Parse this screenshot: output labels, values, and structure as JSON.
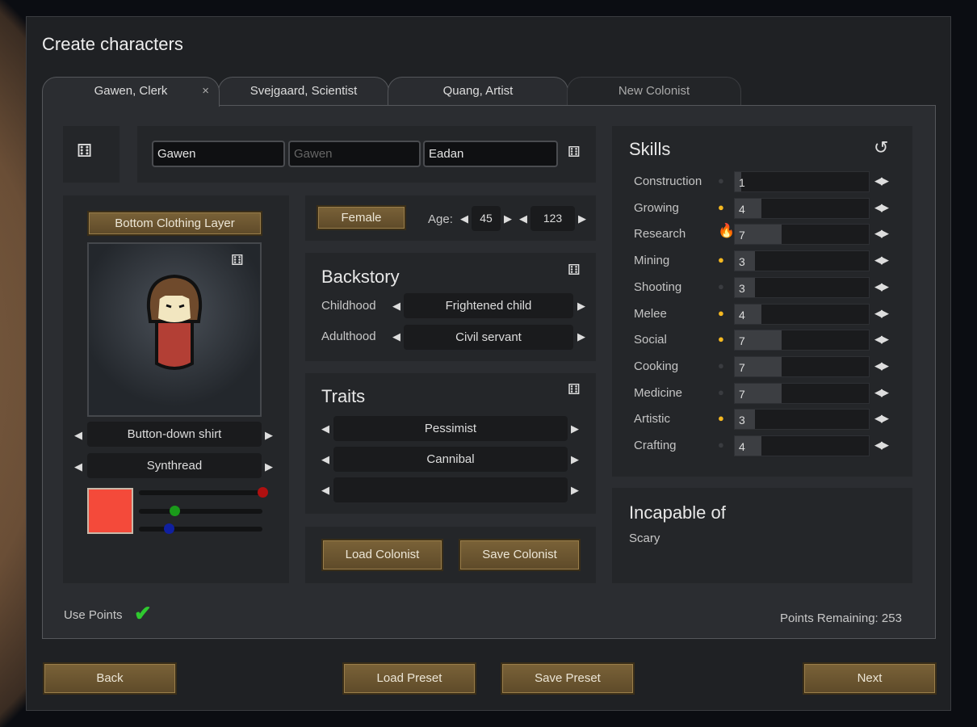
{
  "window": {
    "title": "Create characters"
  },
  "tabs": [
    {
      "label": "Gawen, Clerk",
      "close": "×"
    },
    {
      "label": "Svejgaard, Scientist"
    },
    {
      "label": "Quang, Artist"
    },
    {
      "label": "New Colonist"
    }
  ],
  "name": {
    "first": "Gawen",
    "nick_placeholder": "Gawen",
    "last": "Eadan"
  },
  "apparel": {
    "layer_button": "Bottom Clothing Layer",
    "item": "Button-down shirt",
    "material": "Synthread",
    "color": "#f44a3a",
    "rgb": {
      "r": 1.0,
      "g": 0.29,
      "b": 0.24
    }
  },
  "gender": {
    "label": "Female"
  },
  "age": {
    "label": "Age:",
    "biological": "45",
    "chronological": "123"
  },
  "backstory": {
    "title": "Backstory",
    "childhood_label": "Childhood",
    "childhood": "Frightened child",
    "adulthood_label": "Adulthood",
    "adulthood": "Civil servant"
  },
  "traits": {
    "title": "Traits",
    "items": [
      "Pessimist",
      "Cannibal",
      ""
    ]
  },
  "actions": {
    "load_colonist": "Load Colonist",
    "save_colonist": "Save Colonist"
  },
  "skills": {
    "title": "Skills",
    "max": 20,
    "items": [
      {
        "name": "Construction",
        "value": "1",
        "passion": "none"
      },
      {
        "name": "Growing",
        "value": "4",
        "passion": "minor"
      },
      {
        "name": "Research",
        "value": "7",
        "passion": "major"
      },
      {
        "name": "Mining",
        "value": "3",
        "passion": "minor"
      },
      {
        "name": "Shooting",
        "value": "3",
        "passion": "none"
      },
      {
        "name": "Melee",
        "value": "4",
        "passion": "minor"
      },
      {
        "name": "Social",
        "value": "7",
        "passion": "minor"
      },
      {
        "name": "Cooking",
        "value": "7",
        "passion": "none"
      },
      {
        "name": "Medicine",
        "value": "7",
        "passion": "none"
      },
      {
        "name": "Artistic",
        "value": "3",
        "passion": "minor"
      },
      {
        "name": "Crafting",
        "value": "4",
        "passion": "none"
      }
    ]
  },
  "incapable": {
    "title": "Incapable of",
    "items": [
      "Scary"
    ]
  },
  "points": {
    "use_label": "Use Points",
    "use_checked": true,
    "remaining": "Points Remaining: 253"
  },
  "footer": {
    "back": "Back",
    "load_preset": "Load Preset",
    "save_preset": "Save Preset",
    "next": "Next"
  },
  "colors": {
    "button": "#6e5832",
    "panel": "#2b2d31",
    "check": "#2fc92f",
    "flame": "#f5b820"
  }
}
